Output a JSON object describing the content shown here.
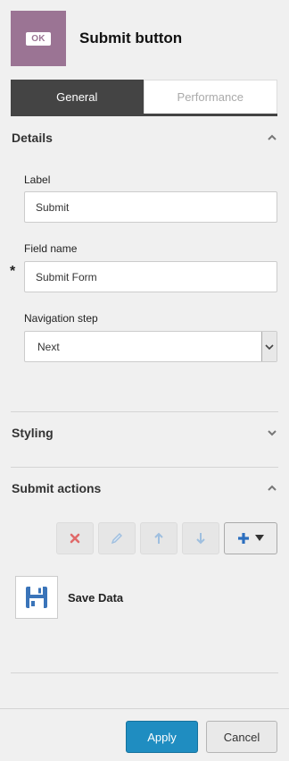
{
  "header": {
    "icon_text": "OK",
    "title": "Submit button"
  },
  "tabs": [
    {
      "label": "General",
      "active": true
    },
    {
      "label": "Performance",
      "active": false
    }
  ],
  "details": {
    "title": "Details",
    "label_field": {
      "label": "Label",
      "value": "Submit"
    },
    "field_name": {
      "label": "Field name",
      "value": "Submit Form",
      "required_marker": "*"
    },
    "navigation_step": {
      "label": "Navigation step",
      "value": "Next"
    }
  },
  "styling": {
    "title": "Styling"
  },
  "submit_actions": {
    "title": "Submit actions",
    "items": [
      {
        "label": "Save Data",
        "icon": "save-icon"
      }
    ]
  },
  "footer": {
    "apply_label": "Apply",
    "cancel_label": "Cancel"
  },
  "colors": {
    "icon_bg": "#9b7494",
    "tab_active": "#444444",
    "apply": "#1f8dc1",
    "delete_icon": "#e06a6a",
    "toolbar_icon": "#9fbfdf",
    "add_icon": "#2c6fbf",
    "save_icon": "#3a74b9"
  }
}
